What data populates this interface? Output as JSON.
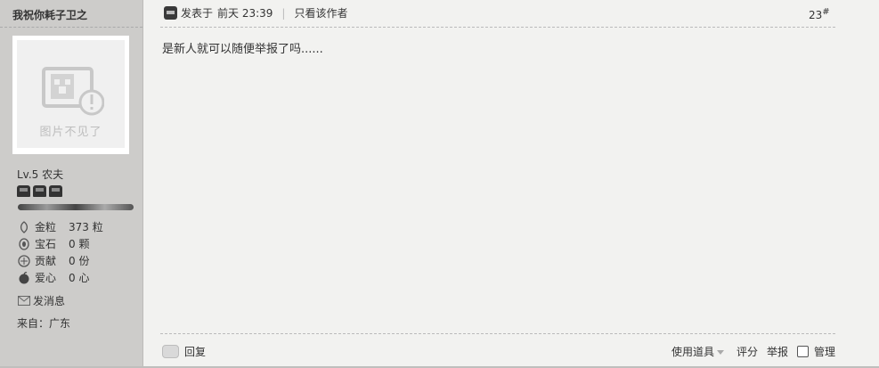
{
  "author": {
    "name": "我祝你耗子卫之",
    "avatar_missing_text": "图片不见了",
    "level": "Lv.5 农夫",
    "stars_count": 3,
    "stats": [
      {
        "icon": "gold-grain-icon",
        "name": "金粒",
        "value": "373 粒"
      },
      {
        "icon": "gem-icon",
        "name": "宝石",
        "value": "0 颗"
      },
      {
        "icon": "contribution-icon",
        "name": "贡献",
        "value": "0 份"
      },
      {
        "icon": "apple-heart-icon",
        "name": "爱心",
        "value": "0 心"
      }
    ],
    "send_message": "发消息",
    "from": "来自：广东"
  },
  "post": {
    "posted_prefix": "发表于",
    "posted_time": "前天 23:39",
    "separator": "|",
    "only_author": "只看该作者",
    "floor_number": "23",
    "floor_mark": "#",
    "content": "是新人就可以随便举报了吗......"
  },
  "footer": {
    "reply": "回复",
    "use_tool": "使用道具",
    "rate": "评分",
    "report": "举报",
    "manage": "管理"
  }
}
